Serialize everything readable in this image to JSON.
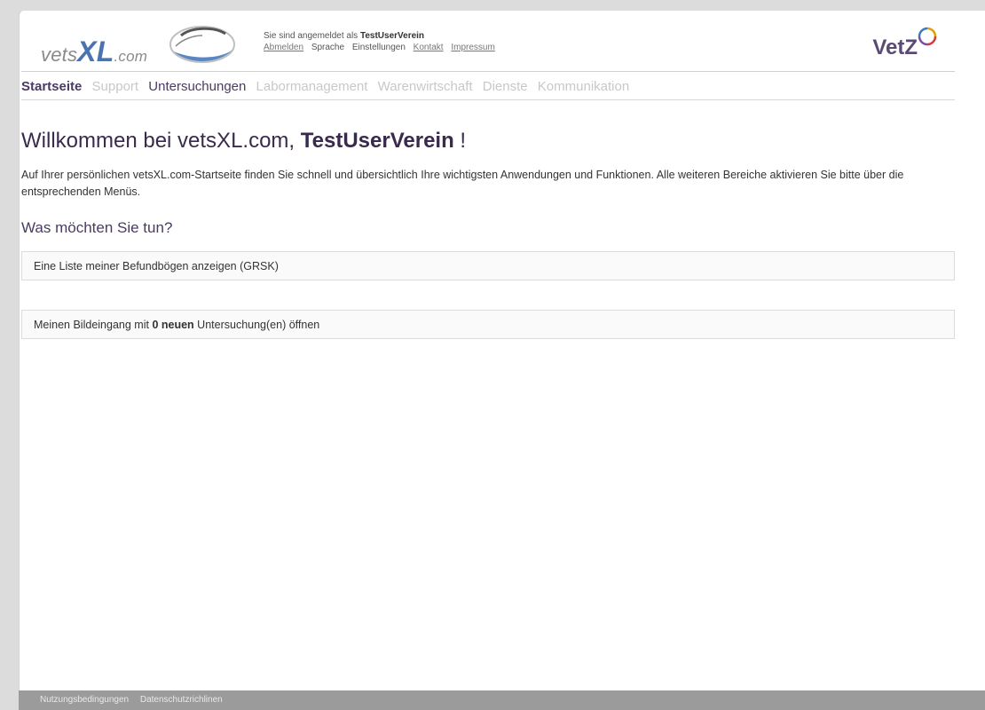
{
  "brand": {
    "logo_main": "vets",
    "logo_xl": "XL",
    "logo_suffix": ".com",
    "partner_logo": "VetZ"
  },
  "user": {
    "login_prefix": "Sie sind angemeldet als",
    "username": "TestUserVerein",
    "menu": {
      "logout": "Abmelden",
      "language": "Sprache",
      "settings": "Einstellungen",
      "contact": "Kontakt",
      "imprint": "Impressum"
    }
  },
  "nav": {
    "items": [
      {
        "label": "Startseite",
        "state": "active"
      },
      {
        "label": "Support",
        "state": "muted"
      },
      {
        "label": "Untersuchungen",
        "state": "dark"
      },
      {
        "label": "Labormanagement",
        "state": "muted"
      },
      {
        "label": "Warenwirtschaft",
        "state": "muted"
      },
      {
        "label": "Dienste",
        "state": "muted"
      },
      {
        "label": "Kommunikation",
        "state": "muted"
      }
    ]
  },
  "main": {
    "welcome_prefix": "Willkommen bei vetsXL.com,",
    "welcome_user": "TestUserVerein",
    "welcome_suffix": "!",
    "intro": "Auf Ihrer persönlichen vetsXL.com-Startseite finden Sie schnell und übersichtlich Ihre wichtigsten Anwendungen und Funktionen. Alle weiteren Bereiche aktivieren Sie bitte über die entsprechenden Menüs.",
    "subheading": "Was möchten Sie tun?",
    "action1": "Eine Liste meiner Befundbögen anzeigen (GRSK)",
    "action2_prefix": "Meinen Bildeingang mit",
    "action2_count": "0 neuen",
    "action2_suffix": "Untersuchung(en) öffnen"
  },
  "footer": {
    "terms": "Nutzungsbedingungen",
    "privacy": "Datenschutzrichlinen"
  },
  "colors": {
    "accent_purple": "#4b3a63",
    "logo_blue": "#4a73b0",
    "footer_gray": "#9b9b9b"
  }
}
